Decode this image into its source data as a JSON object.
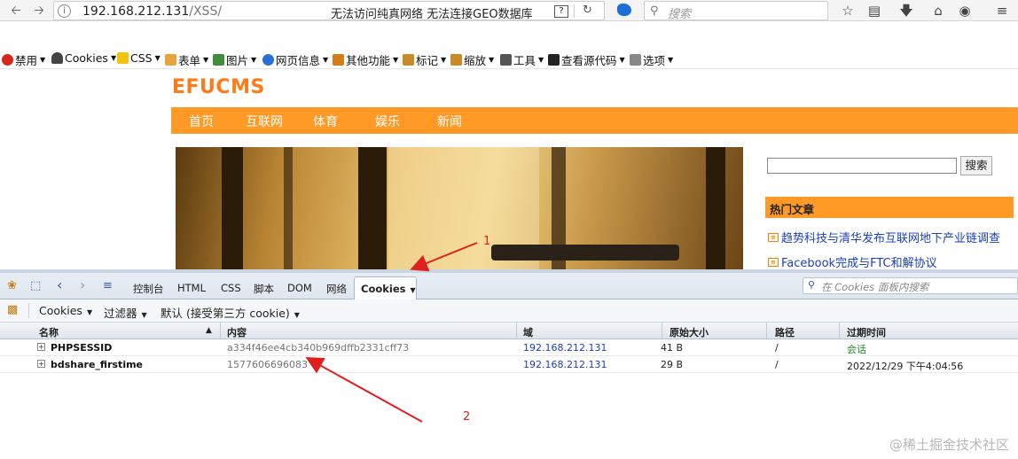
{
  "browser": {
    "url_host": "192.168.212.131",
    "url_path": "/XSS/",
    "status_text": "无法访问纯真网络 无法连接GEO数据库",
    "help_glyph": "?",
    "search_placeholder": "搜索"
  },
  "dev_toolbar": {
    "items": [
      "禁用",
      "Cookies",
      "CSS",
      "表单",
      "图片",
      "网页信息",
      "其他功能",
      "标记",
      "缩放",
      "工具",
      "查看源代码",
      "选项"
    ]
  },
  "page": {
    "logo": "EFUCMS",
    "menu": [
      "首页",
      "互联网",
      "体育",
      "娱乐",
      "新闻"
    ],
    "search_button": "搜索",
    "hot_heading": "热门文章",
    "hot_items": [
      "趋势科技与清华发布互联网地下产业链调查",
      "Facebook完成与FTC和解协议"
    ]
  },
  "firebug": {
    "tabs": [
      "控制台",
      "HTML",
      "CSS",
      "脚本",
      "DOM",
      "网络"
    ],
    "active_tab": "Cookies",
    "search_placeholder": "在 Cookies 面板内搜索",
    "subbar": {
      "cookies_menu": "Cookies",
      "filter_menu": "过滤器",
      "default_menu": "默认 (接受第三方 cookie)"
    },
    "columns": {
      "name": "名称",
      "value": "内容",
      "domain": "域",
      "size": "原始大小",
      "path": "路径",
      "expires": "过期时间"
    },
    "cookies": [
      {
        "name": "PHPSESSID",
        "value": "a334f46ee4cb340b969dffb2331cff73",
        "domain": "192.168.212.131",
        "size": "41 B",
        "path": "/",
        "expires": "会话"
      },
      {
        "name": "bdshare_firstime",
        "value": "1577606696083",
        "domain": "192.168.212.131",
        "size": "29 B",
        "path": "/",
        "expires": "2022/12/29 下午4:04:56"
      }
    ]
  },
  "annotations": {
    "arrow1_label": "1",
    "arrow2_label": "2"
  },
  "watermark": "@稀土掘金技术社区"
}
